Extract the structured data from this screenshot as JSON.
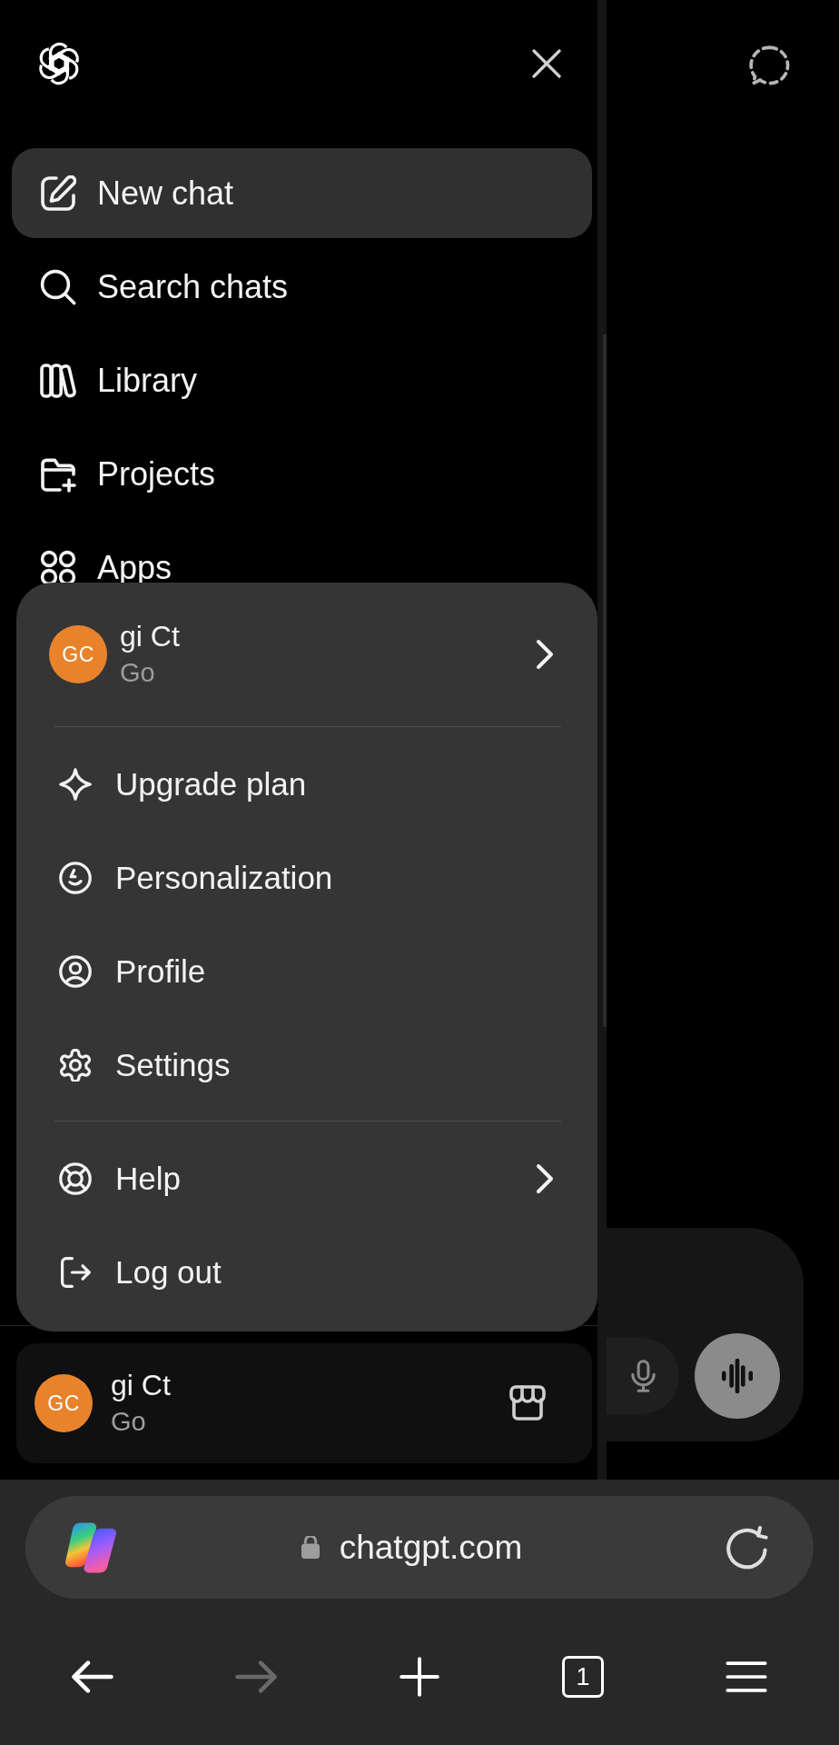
{
  "sidebar": {
    "nav_items": [
      {
        "label": "New chat",
        "selected": true
      },
      {
        "label": "Search chats",
        "selected": false
      },
      {
        "label": "Library",
        "selected": false
      },
      {
        "label": "Projects",
        "selected": false
      },
      {
        "label": "Apps",
        "selected": false
      }
    ],
    "account": {
      "initials": "GC",
      "name": "gi Ct",
      "plan": "Go"
    }
  },
  "account_menu": {
    "account": {
      "initials": "GC",
      "name": "gi Ct",
      "plan": "Go",
      "has_submenu": true
    },
    "sections": [
      {
        "items": [
          {
            "label": "Upgrade plan",
            "has_submenu": false
          },
          {
            "label": "Personalization",
            "has_submenu": false
          },
          {
            "label": "Profile",
            "has_submenu": false
          },
          {
            "label": "Settings",
            "has_submenu": false
          }
        ]
      },
      {
        "items": [
          {
            "label": "Help",
            "has_submenu": true
          },
          {
            "label": "Log out",
            "has_submenu": false
          }
        ]
      }
    ]
  },
  "browser": {
    "address_bar": {
      "url": "chatgpt.com",
      "secure": true
    },
    "toolbar": [
      {
        "kind": "back",
        "disabled": false
      },
      {
        "kind": "forward",
        "disabled": true
      },
      {
        "kind": "new_tab",
        "disabled": false
      },
      {
        "kind": "tabs",
        "count": "1",
        "disabled": false
      },
      {
        "kind": "menu",
        "disabled": false
      }
    ]
  }
}
